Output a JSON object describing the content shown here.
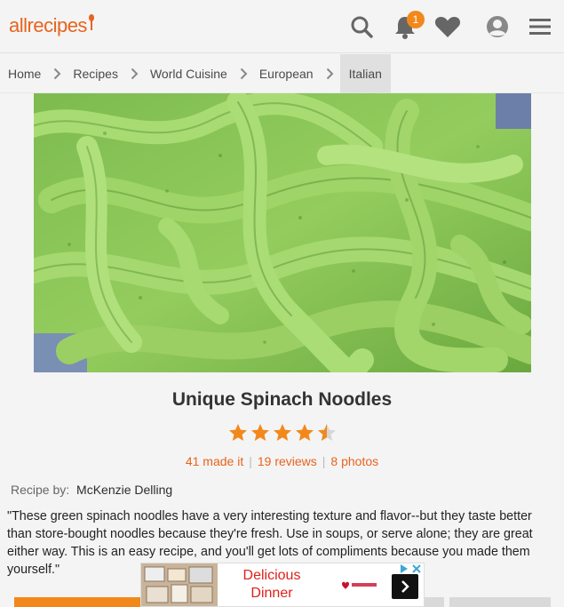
{
  "header": {
    "logo_text": "allrecipes",
    "notification_count": "1",
    "accent_color": "#e8631e",
    "icons": [
      "search-icon",
      "bell-icon",
      "heart-icon",
      "user-icon",
      "menu-icon"
    ]
  },
  "breadcrumb": {
    "items": [
      {
        "label": "Home"
      },
      {
        "label": "Recipes"
      },
      {
        "label": "World Cuisine"
      },
      {
        "label": "European"
      },
      {
        "label": "Italian"
      }
    ]
  },
  "recipe": {
    "title": "Unique Spinach Noodles",
    "rating": 4.5,
    "made_it": "41 made it",
    "reviews": "19 reviews",
    "photos": "8 photos",
    "byline_label": "Recipe by:",
    "author": "McKenzie Delling",
    "description": "\"These green spinach noodles have a very interesting texture and flavor--but they taste better than store-bought noodles because they're fresh. Use in soups, or serve alone; they are great either way. This is an easy recipe, and you'll get lots of compliments because you made them yourself.\""
  },
  "ad": {
    "headline_line1": "Delicious",
    "headline_line2": "Dinner"
  }
}
